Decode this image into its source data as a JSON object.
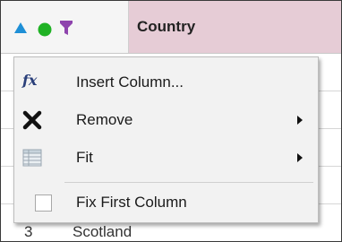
{
  "header": {
    "column_title": "Country",
    "icons": [
      "sort-ascending-icon",
      "status-dot-icon",
      "filter-icon"
    ]
  },
  "background_row": {
    "number": "3",
    "value": "Scotland"
  },
  "context_menu": {
    "items": [
      {
        "icon": "fx-icon",
        "icon_text": "fx",
        "label": "Insert Column...",
        "has_submenu": false
      },
      {
        "icon": "remove-x-icon",
        "label": "Remove",
        "has_submenu": true
      },
      {
        "icon": "fit-grid-icon",
        "label": "Fit",
        "has_submenu": true
      },
      {
        "icon": "checkbox",
        "label": "Fix First Column",
        "has_submenu": false,
        "checked": false
      }
    ]
  },
  "colors": {
    "header_highlight": "#e6ccd6",
    "sort_icon": "#1e8fd6",
    "dot_icon": "#1fb224",
    "filter_icon": "#8e44ad",
    "menu_bg": "#f2f2f2"
  }
}
